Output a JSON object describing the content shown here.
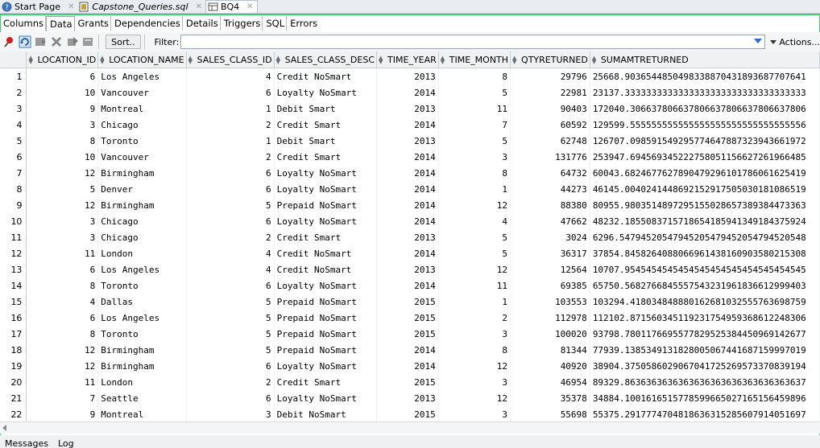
{
  "doc_tabs": [
    {
      "label": "Start Page",
      "icon": "help-circle-icon",
      "italic": false,
      "active": false
    },
    {
      "label": "Capstone_Queries.sql",
      "icon": "sql-file-icon",
      "italic": true,
      "active": false
    },
    {
      "label": "BQ4",
      "icon": "connection-icon",
      "italic": false,
      "active": true
    }
  ],
  "sub_tabs": [
    "Columns",
    "Data",
    "Grants",
    "Dependencies",
    "Details",
    "Triggers",
    "SQL",
    "Errors"
  ],
  "active_sub_tab": "Data",
  "toolbar": {
    "icons": [
      "pin-icon",
      "refresh-icon",
      "insert-row-icon",
      "delete-row-icon",
      "commit-icon",
      "rollback-icon"
    ],
    "sort_label": "Sort..",
    "filter_label": "Filter:",
    "filter_value": "",
    "actions_label": "Actions..."
  },
  "grid": {
    "columns": [
      "LOCATION_ID",
      "LOCATION_NAME",
      "SALES_CLASS_ID",
      "SALES_CLASS_DESC",
      "TIME_YEAR",
      "TIME_MONTH",
      "QTYRETURNED",
      "SUMAMTRETURNED"
    ],
    "rows": [
      [
        "1",
        "6",
        "Los Angeles",
        "4",
        "Credit NoSmart",
        "2013",
        "8",
        "29796",
        "25668.9036544850498338870431893687707641"
      ],
      [
        "2",
        "10",
        "Vancouver",
        "6",
        "Loyalty NoSmart",
        "2014",
        "5",
        "22981",
        "23137.3333333333333333333333333333333333"
      ],
      [
        "3",
        "9",
        "Montreal",
        "1",
        "Debit Smart",
        "2013",
        "11",
        "90403",
        "172040.306637806637806637806637806637806"
      ],
      [
        "4",
        "3",
        "Chicago",
        "2",
        "Credit Smart",
        "2014",
        "7",
        "60592",
        "129599.555555555555555555555555555555556"
      ],
      [
        "5",
        "8",
        "Toronto",
        "1",
        "Debit Smart",
        "2013",
        "5",
        "62748",
        "126707.098591549295774647887323943661972"
      ],
      [
        "6",
        "10",
        "Vancouver",
        "2",
        "Credit Smart",
        "2014",
        "3",
        "131776",
        "253947.694569345222758051156627261966485"
      ],
      [
        "7",
        "12",
        "Birmingham",
        "6",
        "Loyalty NoSmart",
        "2014",
        "8",
        "64732",
        "60043.6824677627890479296101786061625419"
      ],
      [
        "8",
        "5",
        "Denver",
        "6",
        "Loyalty NoSmart",
        "2014",
        "1",
        "44273",
        "46145.0040241448692152917505030181086519"
      ],
      [
        "9",
        "12",
        "Birmingham",
        "5",
        "Prepaid NoSmart",
        "2014",
        "12",
        "88380",
        "80955.9803514897295155028657389384473363"
      ],
      [
        "10",
        "3",
        "Chicago",
        "6",
        "Loyalty NoSmart",
        "2014",
        "4",
        "47662",
        "48232.1855083715718654185941349184375924"
      ],
      [
        "11",
        "3",
        "Chicago",
        "2",
        "Credit Smart",
        "2013",
        "5",
        "3024",
        "6296.54794520547945205479452054794520548"
      ],
      [
        "12",
        "11",
        "London",
        "4",
        "Credit NoSmart",
        "2014",
        "5",
        "36317",
        "37854.8458264088066961438160903580215308"
      ],
      [
        "13",
        "6",
        "Los Angeles",
        "4",
        "Credit NoSmart",
        "2013",
        "12",
        "12564",
        "10707.9545454545454545454545454545454545"
      ],
      [
        "14",
        "8",
        "Toronto",
        "6",
        "Loyalty NoSmart",
        "2014",
        "11",
        "69385",
        "65750.5682766845557543231961836612999403"
      ],
      [
        "15",
        "4",
        "Dallas",
        "5",
        "Prepaid NoSmart",
        "2015",
        "1",
        "103553",
        "103294.418034848880162681032555763698759"
      ],
      [
        "16",
        "6",
        "Los Angeles",
        "5",
        "Prepaid NoSmart",
        "2015",
        "2",
        "112978",
        "112102.871560345119231754959368612248306"
      ],
      [
        "17",
        "8",
        "Toronto",
        "5",
        "Prepaid NoSmart",
        "2015",
        "3",
        "100020",
        "93798.7801176695577829525384450969142677"
      ],
      [
        "18",
        "12",
        "Birmingham",
        "5",
        "Prepaid NoSmart",
        "2014",
        "8",
        "81344",
        "77939.1385349131828005067441687159997019"
      ],
      [
        "19",
        "12",
        "Birmingham",
        "6",
        "Loyalty NoSmart",
        "2014",
        "12",
        "40920",
        "38904.3750586029067041725269573370839194"
      ],
      [
        "20",
        "11",
        "London",
        "2",
        "Credit Smart",
        "2015",
        "3",
        "46954",
        "89329.8636363636363636363636363636363637"
      ],
      [
        "21",
        "7",
        "Seattle",
        "6",
        "Loyalty NoSmart",
        "2013",
        "12",
        "35378",
        "34884.1001616515778599665027165156459896"
      ],
      [
        "22",
        "9",
        "Montreal",
        "3",
        "Debit NoSmart",
        "2015",
        "3",
        "55698",
        "55375.2917774704818636315285607914051697"
      ]
    ]
  },
  "bottom_tabs": [
    "Messages",
    "Log"
  ],
  "colors": {
    "frame_green": "#3cd26b",
    "filter_dropdown": "#3366cc"
  }
}
